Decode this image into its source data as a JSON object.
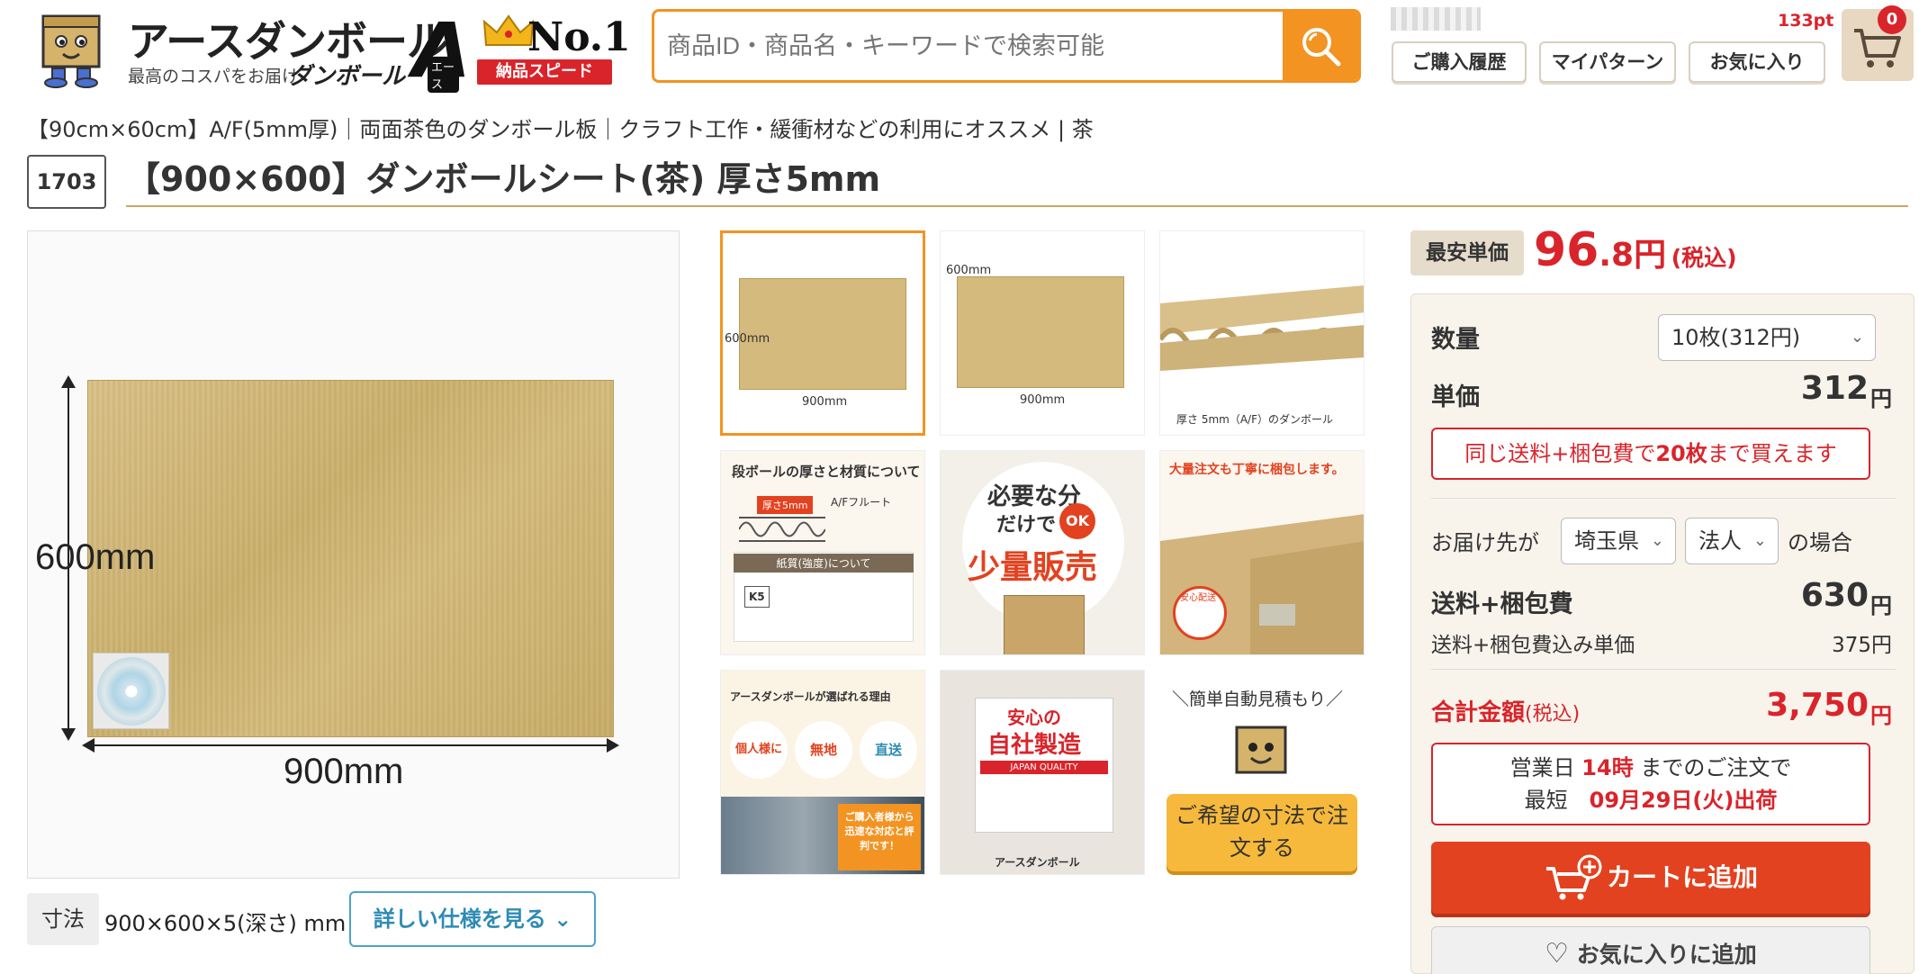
{
  "header": {
    "logo_title": "アースダンボール",
    "logo_sub": "最高のコスパをお届け",
    "logo_sub2": "ダンボール",
    "logo_a": "A",
    "logo_ace": "エース",
    "no1": "No.1",
    "no1_band": "納品スピード",
    "search_placeholder": "商品ID・商品名・キーワードで検索可能",
    "points": "133pt",
    "history_label": "ご購入履歴",
    "pattern_label": "マイパターン",
    "favorites_label": "お気に入り",
    "cart_count": "0"
  },
  "breadcrumb": "【90cm×60cm】A/F(5mm厚)｜両面茶色のダンボール板｜クラフト工作・緩衝材などの利用にオススメ | 茶",
  "product": {
    "id": "1703",
    "title": "【900×600】ダンボールシート(茶) 厚さ5mm",
    "dim_height": "600mm",
    "dim_width": "900mm"
  },
  "spec": {
    "tag": "寸法",
    "value": "900×600×5(深さ) mm",
    "details_button": "詳しい仕様を見る"
  },
  "thumbs": {
    "t1_h": "600mm",
    "t1_w": "900mm",
    "t2_h": "600mm",
    "t2_w": "900mm",
    "t3_caption": "厚さ 5mm（A/F）のダンボール",
    "t4_title": "段ボールの厚さと材質について",
    "t4_badge": "厚さ5mm",
    "t4_flute": "A/Fフルート",
    "t4_sub": "紙質(強度)について",
    "t4_k5": "K5",
    "t5_line1": "必要な分",
    "t5_line2": "だけで",
    "t5_ok": "OK",
    "t5_big": "少量販売",
    "t6_title": "大量注文も丁寧に梱包します。",
    "t6_badge": "安心配送",
    "t7_title": "アースダンボールが選ばれる理由",
    "t7_b1": "個人様に",
    "t7_b2": "無地",
    "t7_b3": "直送",
    "t7_note": "ご購入者様から迅速な対応と評判です！",
    "t8_line1": "安心の",
    "t8_line2": "自社製造",
    "t8_flag": "JAPAN QUALITY",
    "t8_footer": "アースダンボール",
    "t9_top": "＼簡単自動見積もり／",
    "t9_btn": "ご希望の寸法で注文する"
  },
  "pricing": {
    "lowest_tag": "最安単価",
    "lowest_price": "96",
    "lowest_decimal": ".8円",
    "lowest_tax": "(税込)",
    "qty_label": "数量",
    "qty_select": "10枚(312円)",
    "unit_label": "単価",
    "unit_value": "312",
    "yen": "円",
    "same_shipping_pre": "同じ送料+梱包費で",
    "same_shipping_qty": "20枚",
    "same_shipping_post": "まで買えます",
    "deliver_label": "お届け先が",
    "prefecture": "埼玉県",
    "customer_type": "法人",
    "deliver_suffix": "の場合",
    "shipping_label": "送料+梱包費",
    "shipping_value": "630",
    "incl_unit_label": "送料+梱包費込み単価",
    "incl_unit_value": "375円",
    "total_label": "合計金額",
    "total_tax": "(税込)",
    "total_value": "3,750",
    "ship_line1_pre": "営業日",
    "ship_line1_time": "14時",
    "ship_line1_post": "までのご注文で",
    "ship_line2_pre": "最短",
    "ship_line2_date": "09月29日(火)出荷",
    "add_cart": "カートに追加",
    "add_fav": "お気に入りに追加"
  },
  "colors": {
    "accent_orange": "#f39321",
    "price_red": "#d9242b",
    "cart_button": "#e2421f",
    "link_blue": "#2e8bb5"
  }
}
